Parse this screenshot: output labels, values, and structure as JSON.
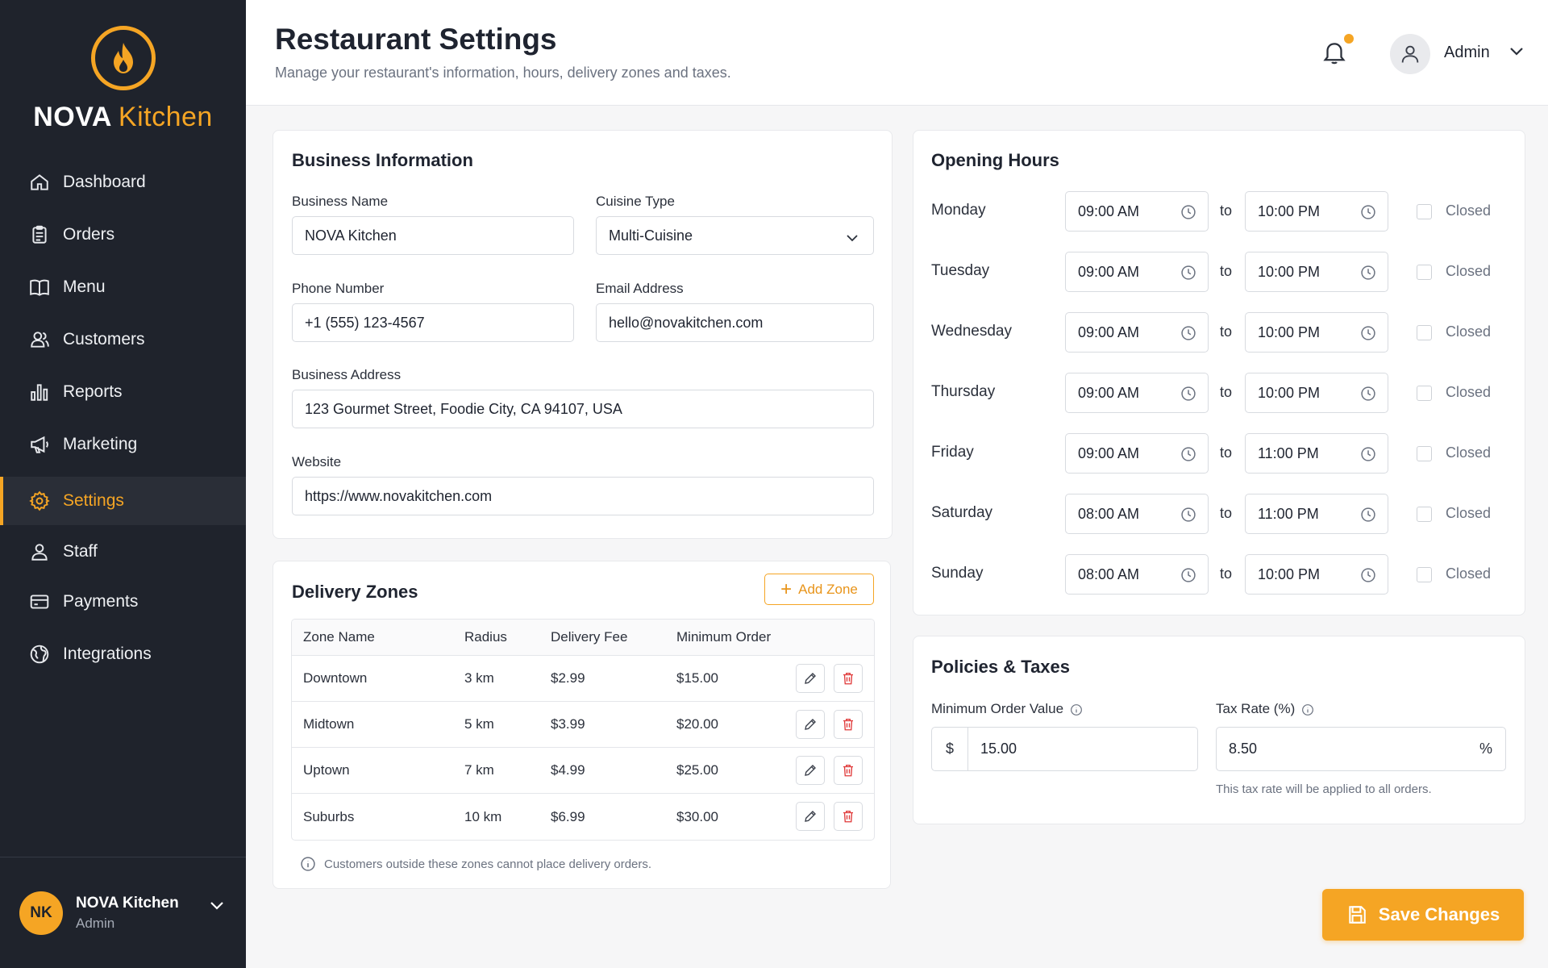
{
  "brand": {
    "name_bold": "NOVA",
    "name_light": "Kitchen",
    "accent": "#f5a524",
    "sidebar_bg": "#1f232c"
  },
  "sidebar": {
    "items": [
      {
        "label": "Dashboard",
        "icon": "home-icon"
      },
      {
        "label": "Orders",
        "icon": "clipboard-icon"
      },
      {
        "label": "Menu",
        "icon": "book-icon"
      },
      {
        "label": "Customers",
        "icon": "users-icon"
      },
      {
        "label": "Reports",
        "icon": "bar-chart-icon"
      },
      {
        "label": "Marketing",
        "icon": "megaphone-icon"
      },
      {
        "label": "Settings",
        "icon": "gear-icon",
        "active": true
      },
      {
        "label": "Staff",
        "icon": "user-icon"
      },
      {
        "label": "Payments",
        "icon": "card-icon"
      },
      {
        "label": "Integrations",
        "icon": "globe-icon"
      }
    ],
    "user": {
      "initials": "NK",
      "name": "NOVA Kitchen",
      "role": "Admin"
    }
  },
  "header": {
    "title": "Restaurant Settings",
    "subtitle": "Manage your restaurant's information, hours, delivery zones and taxes.",
    "user_name": "Admin",
    "has_notification": true
  },
  "business": {
    "title": "Business Information",
    "name_label": "Business Name",
    "name_value": "NOVA Kitchen",
    "cuisine_label": "Cuisine Type",
    "cuisine_value": "Multi-Cuisine",
    "phone_label": "Phone Number",
    "phone_value": "+1 (555) 123-4567",
    "email_label": "Email Address",
    "email_value": "hello@novakitchen.com",
    "address_label": "Business Address",
    "address_value": "123 Gourmet Street, Foodie City, CA 94107, USA",
    "website_label": "Website",
    "website_value": "https://www.novakitchen.com"
  },
  "delivery": {
    "title": "Delivery Zones",
    "add_label": "Add Zone",
    "columns": [
      "Zone Name",
      "Radius",
      "Delivery Fee",
      "Minimum Order"
    ],
    "rows": [
      [
        "Downtown",
        "3 km",
        "$2.99",
        "$15.00"
      ],
      [
        "Midtown",
        "5 km",
        "$3.99",
        "$20.00"
      ],
      [
        "Uptown",
        "7 km",
        "$4.99",
        "$25.00"
      ],
      [
        "Suburbs",
        "10 km",
        "$6.99",
        "$30.00"
      ]
    ],
    "note": "Customers outside these zones cannot place delivery orders."
  },
  "hours": {
    "title": "Opening Hours",
    "to_label": "to",
    "closed_label": "Closed",
    "days": [
      {
        "day": "Monday",
        "open": "09:00 AM",
        "close": "10:00 PM",
        "closed": false
      },
      {
        "day": "Tuesday",
        "open": "09:00 AM",
        "close": "10:00 PM",
        "closed": false
      },
      {
        "day": "Wednesday",
        "open": "09:00 AM",
        "close": "10:00 PM",
        "closed": false
      },
      {
        "day": "Thursday",
        "open": "09:00 AM",
        "close": "10:00 PM",
        "closed": false
      },
      {
        "day": "Friday",
        "open": "09:00 AM",
        "close": "11:00 PM",
        "closed": false
      },
      {
        "day": "Saturday",
        "open": "08:00 AM",
        "close": "11:00 PM",
        "closed": false
      },
      {
        "day": "Sunday",
        "open": "08:00 AM",
        "close": "10:00 PM",
        "closed": false
      }
    ]
  },
  "policies": {
    "title": "Policies & Taxes",
    "min_order_label": "Minimum Order Value",
    "min_order_prefix": "$",
    "min_order_value": "15.00",
    "tax_label": "Tax Rate (%)",
    "tax_value": "8.50",
    "tax_suffix": "%",
    "tax_hint": "This tax rate will be applied to all orders."
  },
  "actions": {
    "save_label": "Save Changes"
  }
}
